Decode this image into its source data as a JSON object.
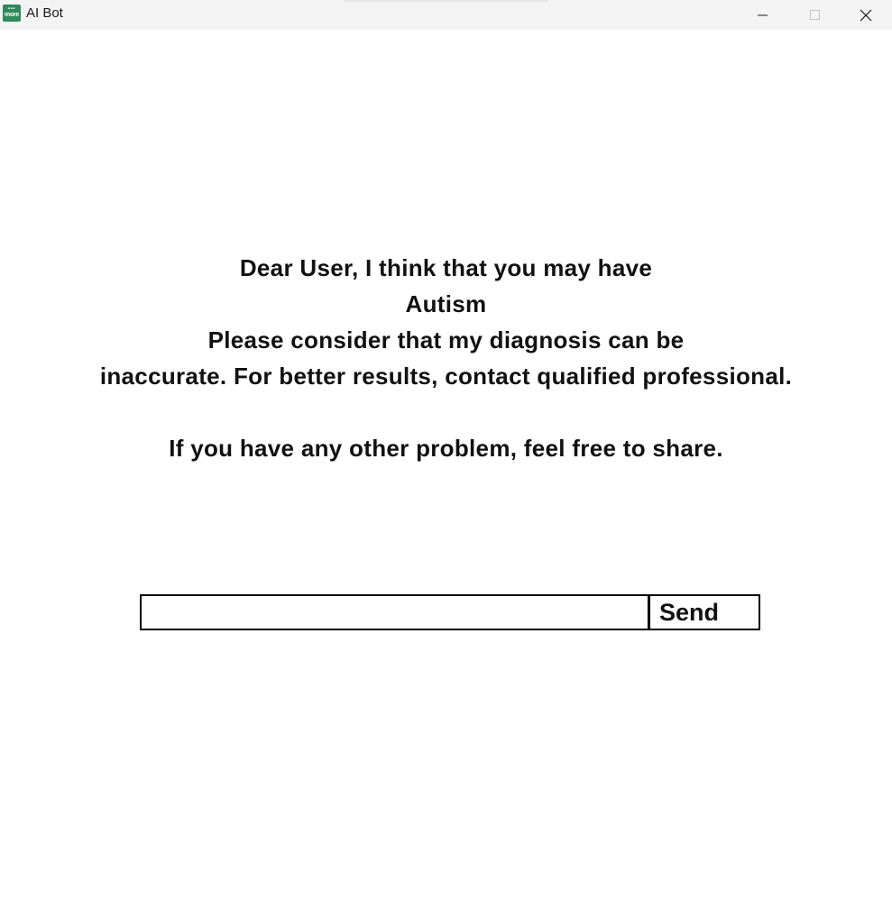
{
  "window": {
    "title": "AI Bot",
    "app_icon": {
      "name": "app-logo-icon",
      "color": "#2f8a5a",
      "text": "more"
    },
    "controls": {
      "minimize_icon": "minimize-icon",
      "maximize_icon": "maximize-icon",
      "close_icon": "close-icon"
    }
  },
  "message": {
    "line1": "Dear User, I think that you may have",
    "line2": "Autism",
    "line3": "Please consider that my diagnosis can be",
    "line4": "inaccurate. For better results, contact qualified professional.",
    "line5": "If you have any other problem, feel free to share."
  },
  "chat": {
    "input_value": "",
    "input_placeholder": "",
    "send_label": "Send"
  }
}
